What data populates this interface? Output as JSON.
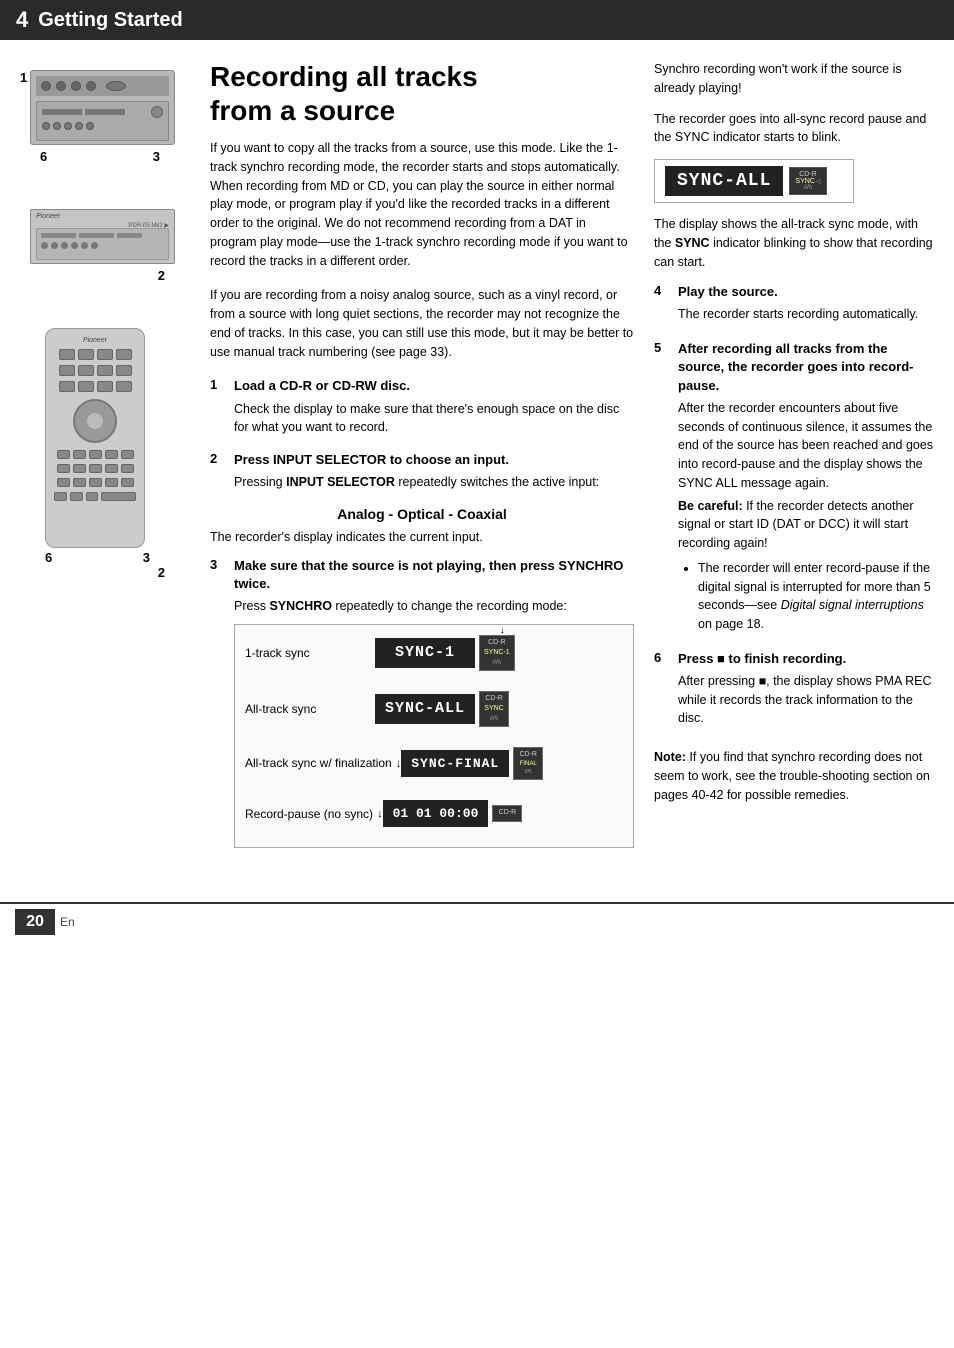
{
  "header": {
    "chapter_num": "4",
    "chapter_title": "Getting Started"
  },
  "article": {
    "title_line1": "Recording all tracks",
    "title_line2": "from a source",
    "intro": "If you want to copy all the tracks from a source, use this mode. Like the 1-track synchro recording mode, the recorder starts and stops automatically. When recording from MD or CD, you can play the source in either normal play mode, or program play if you'd like the recorded tracks in a different order to the original. We do not recommend recording from a DAT in program play mode—use the 1-track synchro recording mode if you want to record the tracks in a different order.",
    "intro2": "If you are recording from a noisy analog source, such as a vinyl record, or from a source with long quiet sections, the recorder may not recognize the end of tracks. In this case, you can still use this mode, but it may be better to use manual track numbering (see page 33)."
  },
  "steps_left": [
    {
      "number": "1",
      "title": "Load a CD-R or CD-RW disc.",
      "body": "Check the display to make sure that there's enough space on the disc for what you want to record."
    },
    {
      "number": "2",
      "title": "Press INPUT SELECTOR to choose an input.",
      "body": "Pressing INPUT SELECTOR repeatedly switches the active input:"
    }
  ],
  "analog_heading": "Analog - Optical - Coaxial",
  "analog_desc": "The recorder's display indicates the current input.",
  "step3": {
    "number": "3",
    "title": "Make sure that the source is not playing, then press SYNCHRO twice.",
    "body": "Press SYNCHRO repeatedly to change the recording mode:"
  },
  "sync_modes": [
    {
      "label": "1-track sync",
      "display": "SYNC-1",
      "indicator_top": "CD-R",
      "indicator_bottom": "SYNC-1"
    },
    {
      "label": "All-track sync",
      "display": "SYNC-ALL",
      "indicator_top": "CD-R",
      "indicator_bottom": "SYNC"
    },
    {
      "label": "All-track sync w/ finalization",
      "display": "SYNC-FINAL",
      "indicator_top": "CD-R",
      "indicator_bottom": "FINAL"
    },
    {
      "label": "Record-pause (no sync)",
      "display": "01 01 00:00",
      "indicator_top": "CD-R",
      "indicator_bottom": ""
    }
  ],
  "right_col": {
    "intro": "Synchro recording won't work if the source is already playing!",
    "desc": "The recorder goes into all-sync record pause and the SYNC indicator starts to blink.",
    "sync_all_display": "SYNC-ALL",
    "sync_all_indicator_top": "CD-R",
    "sync_all_indicator_bottom": "SYNC",
    "desc2": "The display shows the all-track sync mode, with the SYNC indicator blinking to show that recording can start.",
    "step4_number": "4",
    "step4_title": "Play the source.",
    "step4_body": "The recorder starts recording automatically.",
    "step5_number": "5",
    "step5_title": "After recording all tracks from the source, the recorder goes into record-pause.",
    "step5_body": "After the recorder encounters about five seconds of continuous silence, it assumes the end of the source has been reached and goes into record-pause and the display shows the SYNC ALL message again.",
    "be_careful": "Be careful:",
    "be_careful_body": " If the recorder detects another signal or start ID (DAT or DCC) it will start recording again!",
    "bullet1": "The recorder will enter record-pause if the digital signal is interrupted for more than 5 seconds—see ",
    "bullet1_italic": "Digital signal interruptions",
    "bullet1_end": " on page 18.",
    "step6_number": "6",
    "step6_title": "Press ■ to finish recording.",
    "step6_body": "After pressing ■, the display shows PMA REC while it records the track information to the disc.",
    "note": "Note:",
    "note_body": " If you find that synchro recording does not seem to work, see the trouble-shooting section on pages 40-42 for possible remedies."
  },
  "footer": {
    "page_number": "20",
    "page_lang": "En"
  },
  "devices": {
    "label_1": "1",
    "label_6_first": "6",
    "label_3_first": "3",
    "label_2_middle": "2",
    "label_6_bottom": "6",
    "label_3_bottom": "3",
    "label_2_bottom": "2"
  }
}
